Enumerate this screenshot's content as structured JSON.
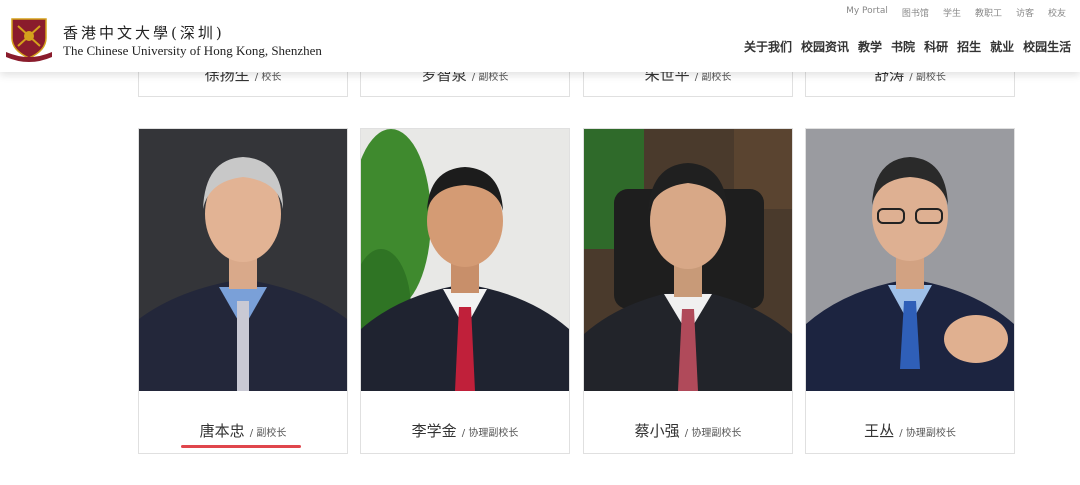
{
  "header": {
    "university_cn": "香港中文大學(深圳)",
    "university_en": "The Chinese University of Hong Kong, Shenzhen",
    "top_links": [
      "My Portal",
      "图书馆",
      "学生",
      "教职工",
      "访客",
      "校友"
    ],
    "main_nav": [
      "关于我们",
      "校园资讯",
      "教学",
      "书院",
      "科研",
      "招生",
      "就业",
      "校园生活"
    ]
  },
  "top_row": [
    {
      "name": "徐扬生",
      "title": "/ 校长"
    },
    {
      "name": "罗智泉",
      "title": "/ 副校长"
    },
    {
      "name": "朱世平",
      "title": "/ 副校长"
    },
    {
      "name": "舒涛",
      "title": "/ 副校长"
    }
  ],
  "leaders": [
    {
      "name": "唐本忠",
      "title": "/ 副校长",
      "tie_color": "#c9c9d4"
    },
    {
      "name": "李学金",
      "title": "/ 协理副校长",
      "tie_color": "#c0203a"
    },
    {
      "name": "蔡小强",
      "title": "/ 协理副校长",
      "tie_color": "#b04a5a"
    },
    {
      "name": "王丛",
      "title": "/ 协理副校长",
      "tie_color": "#2f5fb8"
    }
  ],
  "colors": {
    "accent_underline": "#e0464c",
    "crest": "#8a1c2c",
    "crest_gold": "#d4a21c"
  }
}
